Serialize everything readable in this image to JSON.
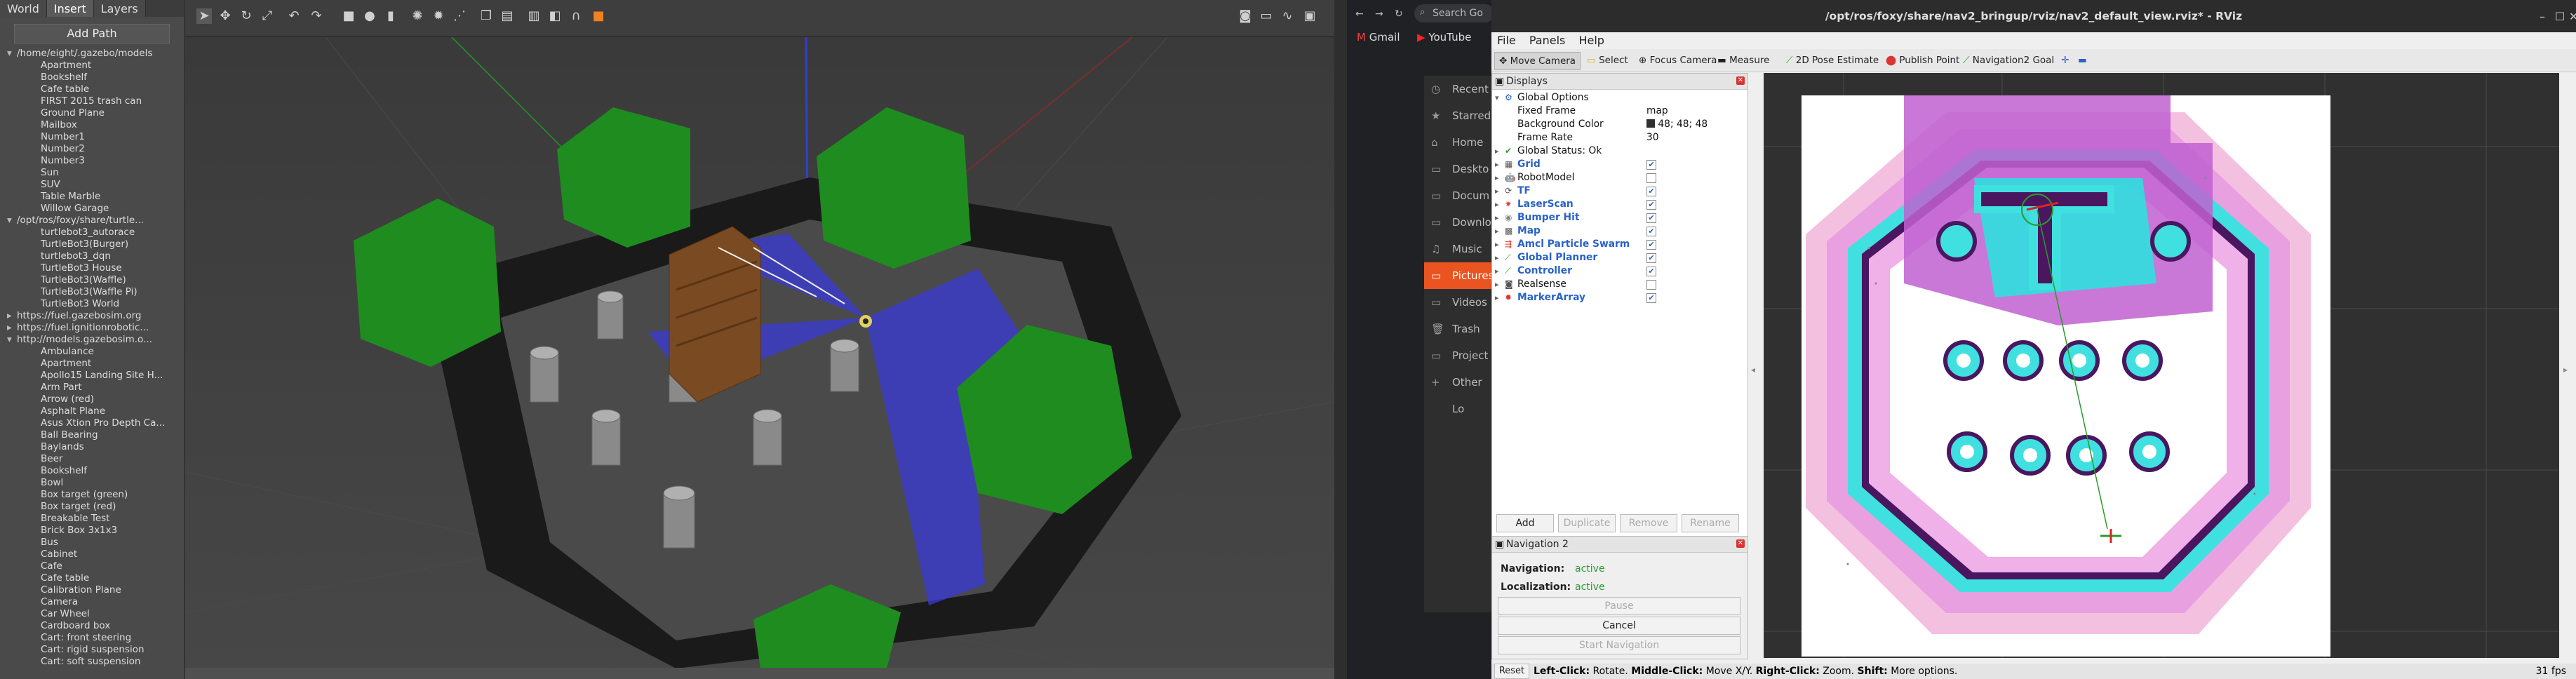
{
  "gazebo": {
    "tabs": [
      "World",
      "Insert",
      "Layers"
    ],
    "add_path_label": "Add Path",
    "tree": [
      {
        "label": "/home/eight/.gazebo/models",
        "children": [
          "Apartment",
          "Bookshelf",
          "Cafe table",
          "FIRST 2015 trash can",
          "Ground Plane",
          "Mailbox",
          "Number1",
          "Number2",
          "Number3",
          "Sun",
          "SUV",
          "Table Marble",
          "Willow Garage"
        ]
      },
      {
        "label": "/opt/ros/foxy/share/turtle...",
        "children": [
          "turtlebot3_autorace",
          "TurtleBot3(Burger)",
          "turtlebot3_dqn",
          "TurtleBot3 House",
          "TurtleBot3(Waffle)",
          "TurtleBot3(Waffle Pi)",
          "TurtleBot3 World"
        ]
      },
      {
        "label": "https://fuel.gazebosim.org",
        "children": []
      },
      {
        "label": "https://fuel.ignitionrobotic...",
        "children": []
      },
      {
        "label": "http://models.gazebosim.o...",
        "children": [
          "Ambulance",
          "Apartment",
          "Apollo15 Landing Site H...",
          "Arm Part",
          "Arrow (red)",
          "Asphalt Plane",
          "Asus Xtion Pro Depth Ca...",
          "Ball Bearing",
          "Baylands",
          "Beer",
          "Bookshelf",
          "Bowl",
          "Box target (green)",
          "Box target (red)",
          "Breakable Test",
          "Brick Box 3x1x3",
          "Bus",
          "Cabinet",
          "Cafe",
          "Cafe table",
          "Calibration Plane",
          "Camera",
          "Car Wheel",
          "Cardboard box",
          "Cart: front steering",
          "Cart: rigid suspension",
          "Cart: soft suspension"
        ]
      }
    ]
  },
  "browser": {
    "address_text": "Search Go",
    "bookmarks": [
      "Gmail",
      "YouTube"
    ],
    "sidebar_items": [
      {
        "label": "Recent",
        "icon": "clock-icon"
      },
      {
        "label": "Starred",
        "icon": "star-icon"
      },
      {
        "label": "Home",
        "icon": "home-icon"
      },
      {
        "label": "Deskto",
        "icon": "folder-icon"
      },
      {
        "label": "Docum",
        "icon": "folder-icon"
      },
      {
        "label": "Downlo",
        "icon": "folder-icon"
      },
      {
        "label": "Music",
        "icon": "music-icon"
      },
      {
        "label": "Pictures",
        "icon": "folder-icon",
        "active": true
      },
      {
        "label": "Videos",
        "icon": "folder-icon"
      },
      {
        "label": "Trash",
        "icon": "trash-icon"
      },
      {
        "label": "Project",
        "icon": "folder-icon"
      },
      {
        "label": "Other Lo",
        "icon": "plus-icon"
      }
    ]
  },
  "rviz": {
    "window_title": "/opt/ros/foxy/share/nav2_bringup/rviz/nav2_default_view.rviz* - RViz",
    "menu": [
      "File",
      "Panels",
      "Help"
    ],
    "tools": [
      "Move Camera",
      "Select",
      "Focus Camera",
      "Measure",
      "2D Pose Estimate",
      "Publish Point",
      "Navigation2 Goal"
    ],
    "displays_title": "Displays",
    "global_options": {
      "label": "Global Options",
      "fixed_frame_label": "Fixed Frame",
      "fixed_frame": "map",
      "bg_color_label": "Background Color",
      "bg_color": "48; 48; 48",
      "frame_rate_label": "Frame Rate",
      "frame_rate": "30"
    },
    "global_status": "Global Status: Ok",
    "displays": [
      {
        "name": "Grid",
        "checked": true,
        "bold": true
      },
      {
        "name": "RobotModel",
        "checked": false,
        "bold": false
      },
      {
        "name": "TF",
        "checked": true,
        "bold": true
      },
      {
        "name": "LaserScan",
        "checked": true,
        "bold": true
      },
      {
        "name": "Bumper Hit",
        "checked": true,
        "bold": true
      },
      {
        "name": "Map",
        "checked": true,
        "bold": true
      },
      {
        "name": "Amcl Particle Swarm",
        "checked": true,
        "bold": true
      },
      {
        "name": "Global Planner",
        "checked": true,
        "bold": true
      },
      {
        "name": "Controller",
        "checked": true,
        "bold": true
      },
      {
        "name": "Realsense",
        "checked": false,
        "bold": false
      },
      {
        "name": "MarkerArray",
        "checked": true,
        "bold": true
      }
    ],
    "display_buttons": [
      "Add",
      "Duplicate",
      "Remove",
      "Rename"
    ],
    "nav2": {
      "title": "Navigation 2",
      "navigation_label": "Navigation:",
      "navigation_value": "active",
      "localization_label": "Localization:",
      "localization_value": "active",
      "buttons": [
        "Pause",
        "Cancel",
        "Start Navigation"
      ]
    },
    "status": {
      "reset": "Reset",
      "left_click": "Left-Click:",
      "left_desc": "Rotate.",
      "middle_click": "Middle-Click:",
      "middle_desc": "Move X/Y.",
      "right_click": "Right-Click:",
      "right_desc": "Zoom.",
      "shift": "Shift:",
      "shift_desc": "More options.",
      "fps": "31 fps"
    }
  }
}
